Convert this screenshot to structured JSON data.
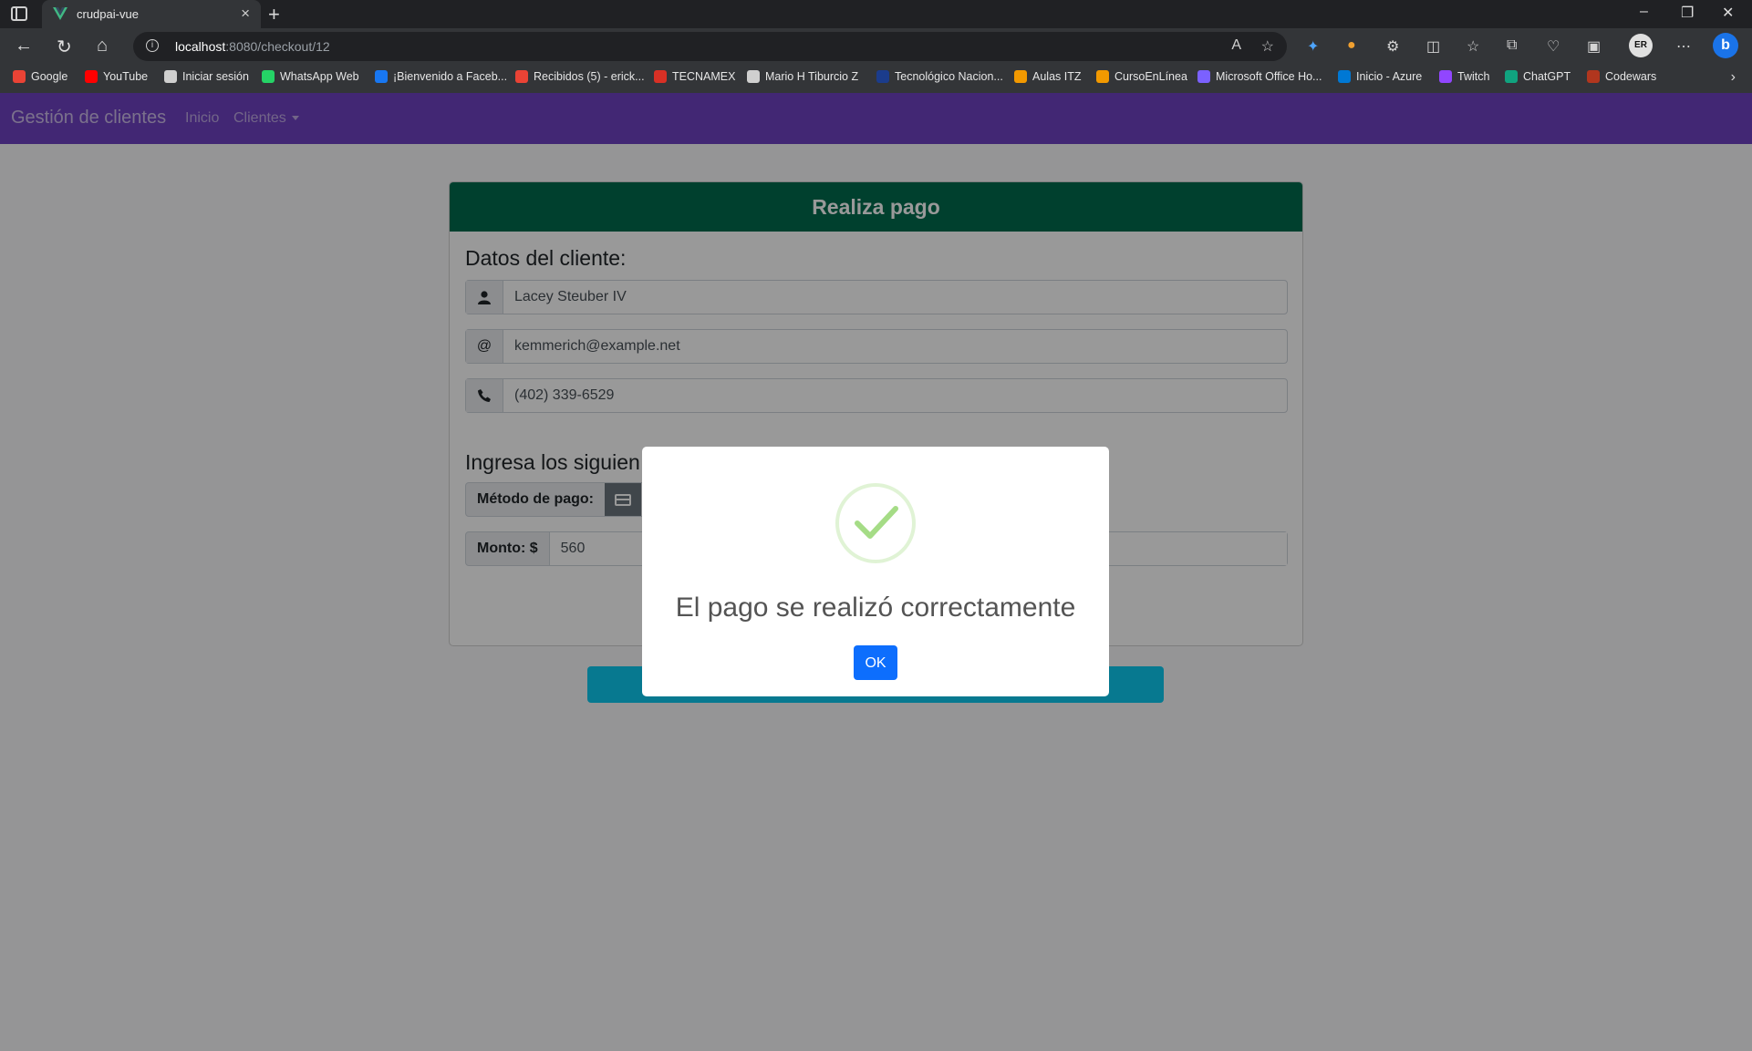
{
  "browser": {
    "tab_title": "crudpai-vue",
    "url_host": "localhost",
    "url_path": ":8080/checkout/12",
    "bookmarks": [
      {
        "label": "Google",
        "icon": "google-icon",
        "color": "#ea4335"
      },
      {
        "label": "YouTube",
        "icon": "youtube-icon",
        "color": "#ff0000"
      },
      {
        "label": "Iniciar sesión",
        "icon": "page-icon",
        "color": "#cfcfcf"
      },
      {
        "label": "WhatsApp Web",
        "icon": "whatsapp-icon",
        "color": "#25d366"
      },
      {
        "label": "¡Bienvenido a Faceb...",
        "icon": "facebook-icon",
        "color": "#1877f2"
      },
      {
        "label": "Recibidos (5) - erick...",
        "icon": "gmail-icon",
        "color": "#ea4335"
      },
      {
        "label": "TECNAMEX",
        "icon": "tecnamex-icon",
        "color": "#d93025"
      },
      {
        "label": "Mario H Tiburcio Z",
        "icon": "page-icon",
        "color": "#cfcfcf"
      },
      {
        "label": "Tecnológico Nacion...",
        "icon": "tecnm-icon",
        "color": "#1b3c8c"
      },
      {
        "label": "Aulas ITZ",
        "icon": "aulas-icon",
        "color": "#f29900"
      },
      {
        "label": "CursoEnLínea",
        "icon": "curso-icon",
        "color": "#f29900"
      },
      {
        "label": "Microsoft Office Ho...",
        "icon": "office-icon",
        "color": "#7b61ff"
      },
      {
        "label": "Inicio - Azure",
        "icon": "azure-icon",
        "color": "#0078d4"
      },
      {
        "label": "Twitch",
        "icon": "twitch-icon",
        "color": "#9146ff"
      },
      {
        "label": "ChatGPT",
        "icon": "chatgpt-icon",
        "color": "#10a37f"
      },
      {
        "label": "Codewars",
        "icon": "codewars-icon",
        "color": "#b1361e"
      }
    ]
  },
  "app": {
    "brand": "Gestión de clientes",
    "nav": {
      "home": "Inicio",
      "clients": "Clientes"
    },
    "colors": {
      "navbar": "#6f42c1",
      "card_header": "#006b4e",
      "submit": "#0dcaf0",
      "ok": "#0d6efd"
    }
  },
  "checkout": {
    "header": "Realiza pago",
    "client_section": "Datos del cliente:",
    "client_name": "Lacey Steuber IV",
    "client_email": "kemmerich@example.net",
    "client_phone": "(402) 339-6529",
    "payment_section": "Ingresa los siguien",
    "method_label": "Método de pago:",
    "amount_label": "Monto: $",
    "amount_value": "560"
  },
  "modal": {
    "title": "El pago se realizó correctamente",
    "ok_label": "OK",
    "icon": "success-check-icon"
  }
}
